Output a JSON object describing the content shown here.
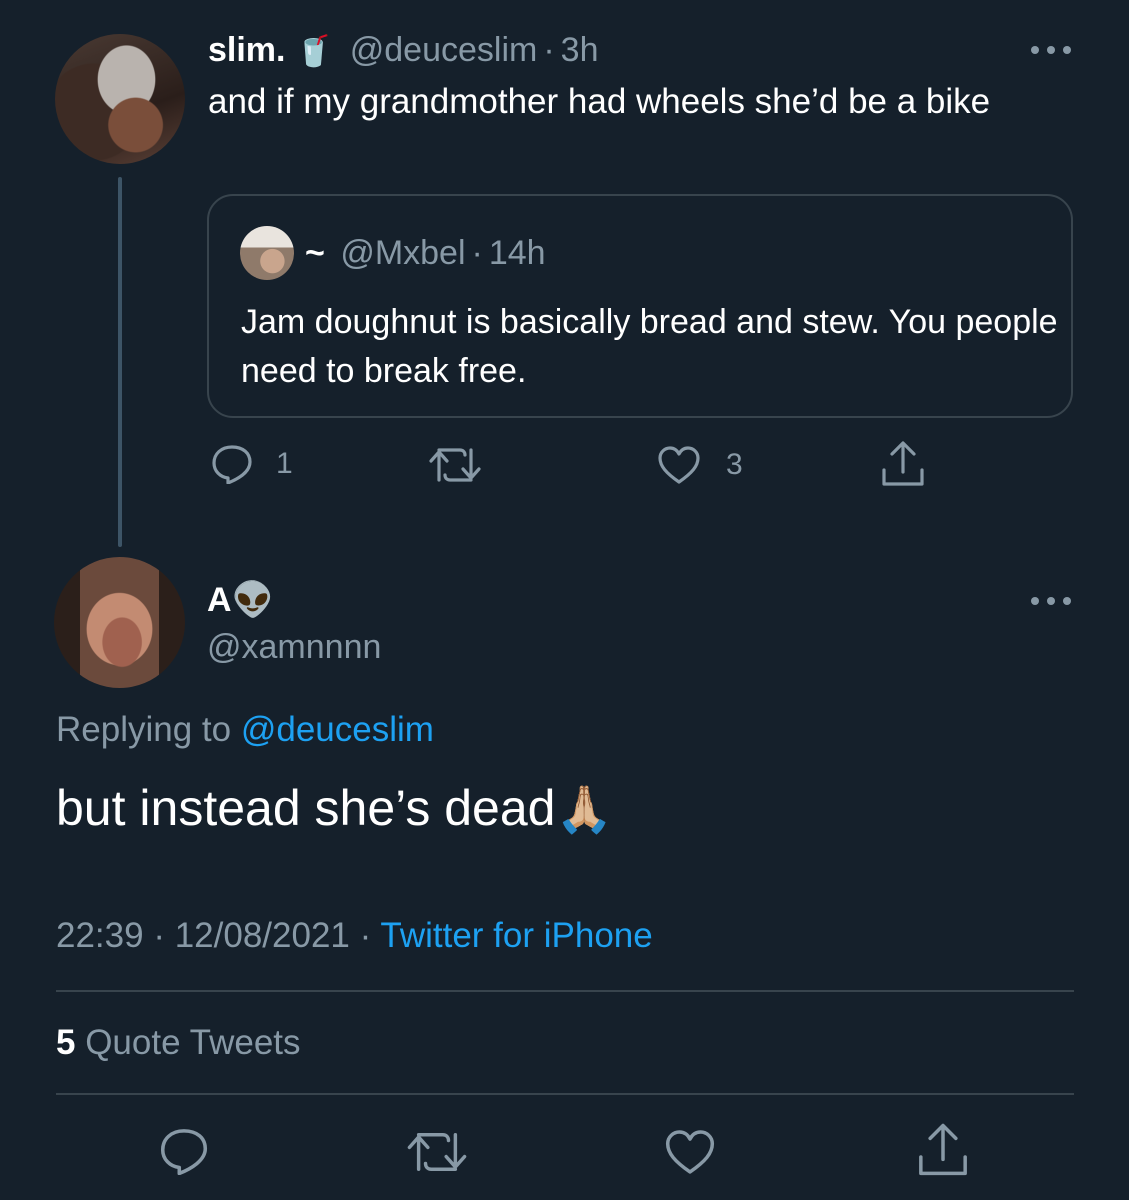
{
  "tweet1": {
    "display_name": "slim.",
    "name_emoji": "🥤",
    "handle": "@deuceslim",
    "separator": "·",
    "time": "3h",
    "text": "and if my grandmother had wheels she’d be a bike",
    "quoted": {
      "display_name": "~",
      "handle": "@Mxbel",
      "separator": "·",
      "time": "14h",
      "text": "Jam doughnut is basically bread and stew. You people need to break free."
    },
    "actions": {
      "reply_count": "1",
      "retweet_count": "",
      "like_count": "3"
    }
  },
  "tweet2": {
    "display_name": "A",
    "name_emoji": "👽",
    "handle": "@xamnnnn",
    "replying_prefix": "Replying to",
    "replying_to": "@deuceslim",
    "text": "but instead she’s dead",
    "text_emoji": "🙏🏼",
    "time": "22:39",
    "separator1": "·",
    "date": "12/08/2021",
    "separator2": "·",
    "source": "Twitter for iPhone",
    "quote_tweets_count": "5",
    "quote_tweets_label": "Quote Tweets"
  },
  "colors": {
    "background": "#15202b",
    "text": "#ffffff",
    "muted": "#8899a6",
    "accent": "#1da1f2",
    "border": "#38444d"
  },
  "icons": [
    "more-icon",
    "reply-icon",
    "retweet-icon",
    "like-icon",
    "share-icon"
  ]
}
